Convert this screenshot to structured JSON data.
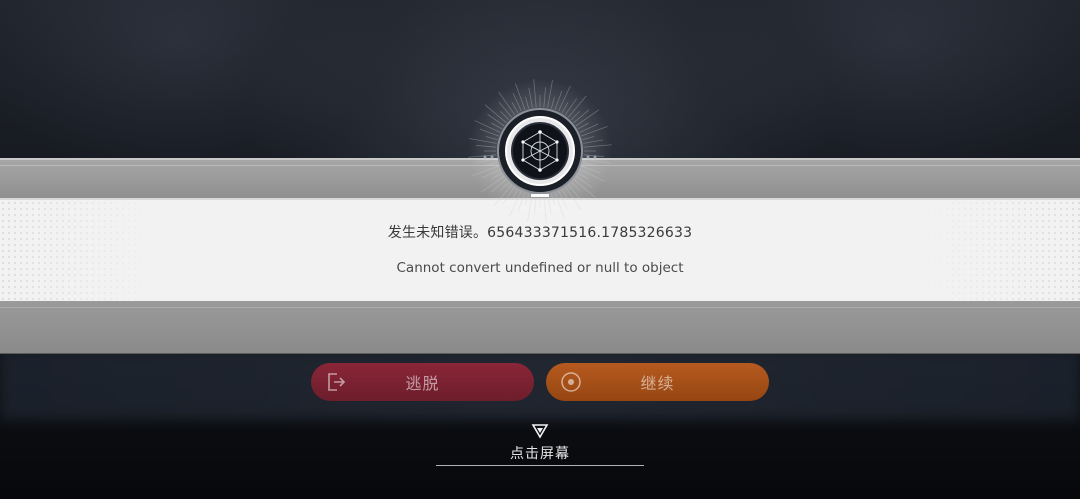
{
  "dialog": {
    "error_title": "发生未知错误。656433371516.1785326633",
    "error_detail": "Cannot convert undefined or null to object"
  },
  "buttons": {
    "escape_label": "逃脱",
    "continue_label": "继续"
  },
  "prompt": {
    "tap_screen_label": "点击屏幕"
  },
  "icons": {
    "emblem": "constellation-emblem-icon",
    "escape": "exit-door-icon",
    "continue": "target-circle-icon",
    "tap": "down-triangle-icon"
  },
  "colors": {
    "escape_button": "#7a2131",
    "continue_button": "#a8501a",
    "panel": "#f2f2f2"
  }
}
